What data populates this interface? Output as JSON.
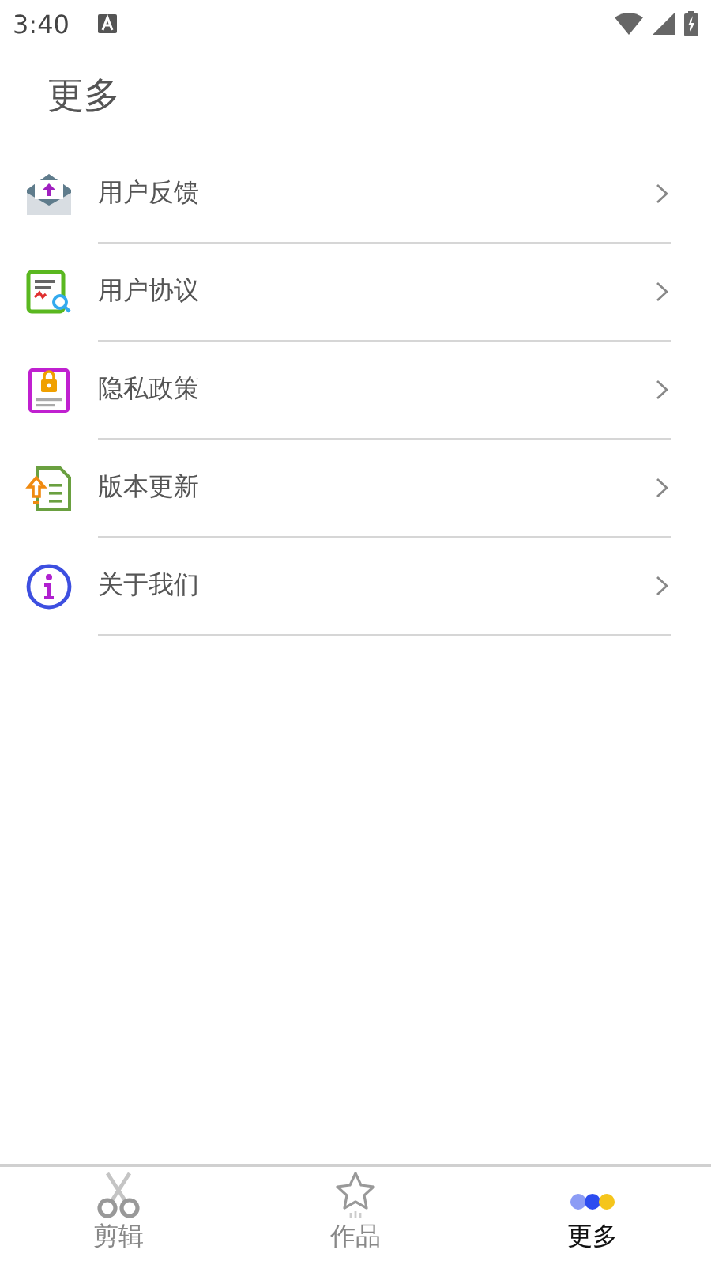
{
  "status_bar": {
    "time": "3:40"
  },
  "title": "更多",
  "menu": [
    {
      "label": "用户反馈",
      "kind": "feedback"
    },
    {
      "label": "用户协议",
      "kind": "agreement"
    },
    {
      "label": "隐私政策",
      "kind": "privacy"
    },
    {
      "label": "版本更新",
      "kind": "update"
    },
    {
      "label": "关于我们",
      "kind": "about"
    }
  ],
  "tabs": [
    {
      "label": "剪辑",
      "kind": "edit",
      "selected": false
    },
    {
      "label": "作品",
      "kind": "works",
      "selected": false
    },
    {
      "label": "更多",
      "kind": "more",
      "selected": true
    }
  ]
}
